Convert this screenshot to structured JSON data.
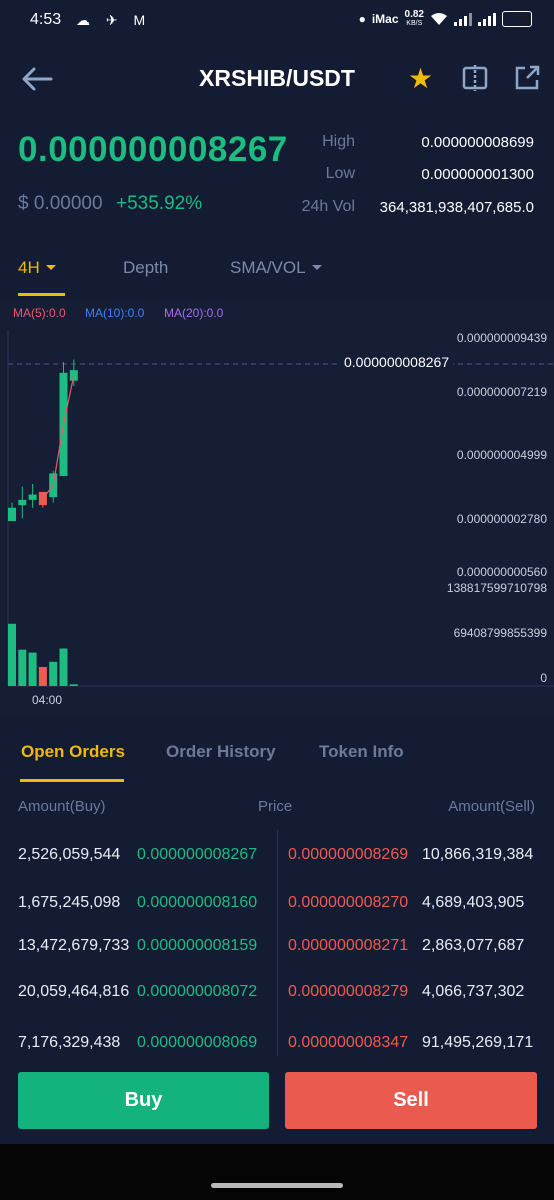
{
  "status": {
    "time": "4:53",
    "left_icons": "☁ ✈ M",
    "imac": "iMac",
    "speed": "0.82",
    "speed_unit": "KB/S",
    "battery": "59"
  },
  "header": {
    "title": "XRSHIB/USDT",
    "back_icon": "arrow-left-icon",
    "favorite_icon": "star-icon",
    "compare_icon": "split-view-icon",
    "share_icon": "share-icon"
  },
  "ticker": {
    "last_price": "0.000000008267",
    "usd_price": "$ 0.00000",
    "change_pct": "+535.92%",
    "high_label": "High",
    "high_value": "0.000000008699",
    "low_label": "Low",
    "low_value": "0.000000001300",
    "vol_label": "24h Vol",
    "vol_value": "364,381,938,407,685.0"
  },
  "chart_tabs": {
    "interval": "4H",
    "depth": "Depth",
    "indicators": "SMA/VOL"
  },
  "indicators": {
    "ma5": "MA(5):0.0",
    "ma10": "MA(10):0.0",
    "ma20": "MA(20):0.0"
  },
  "chart_axis": {
    "p1": "0.000000009439",
    "p2": "0.000000007219",
    "p3": "0.000000004999",
    "p4": "0.000000002780",
    "p5": "0.000000000560",
    "v1": "138817599710798",
    "v2": "69408799855399",
    "v3": "0",
    "current": "0.000000008267",
    "time": "04:00"
  },
  "chart_data": {
    "type": "candlestick",
    "price_range": [
      5.6e-10,
      9.439e-09
    ],
    "volume_range": [
      0,
      138817599710798
    ],
    "candles": [
      {
        "open": 2.6e-09,
        "close": 3.1e-09,
        "high": 3.3e-09,
        "low": 2.6e-09,
        "vol": 108000000000000,
        "dir": "up"
      },
      {
        "open": 3.2e-09,
        "close": 3.4e-09,
        "high": 3.9e-09,
        "low": 2.7e-09,
        "vol": 63000000000000,
        "dir": "up"
      },
      {
        "open": 3.4e-09,
        "close": 3.6e-09,
        "high": 4e-09,
        "low": 3.1e-09,
        "vol": 58000000000000,
        "dir": "up"
      },
      {
        "open": 3.7e-09,
        "close": 3.2e-09,
        "high": 3.7e-09,
        "low": 3.1e-09,
        "vol": 33000000000000,
        "dir": "down"
      },
      {
        "open": 3.5e-09,
        "close": 4.4e-09,
        "high": 4.5e-09,
        "low": 3.3e-09,
        "vol": 42000000000000,
        "dir": "up"
      },
      {
        "open": 4.3e-09,
        "close": 8.2e-09,
        "high": 8.6e-09,
        "low": 4.3e-09,
        "vol": 65000000000000,
        "dir": "up"
      },
      {
        "open": 7.9e-09,
        "close": 8.3e-09,
        "high": 8.7e-09,
        "low": 7.7e-09,
        "vol": 3000000000000,
        "dir": "up"
      }
    ]
  },
  "order_tabs": {
    "open_orders": "Open Orders",
    "order_history": "Order History",
    "token_info": "Token Info"
  },
  "orderbook": {
    "col_buy": "Amount(Buy)",
    "col_price": "Price",
    "col_sell": "Amount(Sell)",
    "rows": [
      {
        "amt_buy": "2,526,059,544",
        "px_buy": "0.000000008267",
        "px_sell": "0.000000008269",
        "amt_sell": "10,866,319,384"
      },
      {
        "amt_buy": "1,675,245,098",
        "px_buy": "0.000000008160",
        "px_sell": "0.000000008270",
        "amt_sell": "4,689,403,905"
      },
      {
        "amt_buy": "13,472,679,733",
        "px_buy": "0.000000008159",
        "px_sell": "0.000000008271",
        "amt_sell": "2,863,077,687"
      },
      {
        "amt_buy": "20,059,464,816",
        "px_buy": "0.000000008072",
        "px_sell": "0.000000008279",
        "amt_sell": "4,066,737,302"
      },
      {
        "amt_buy": "7,176,329,438",
        "px_buy": "0.000000008069",
        "px_sell": "0.000000008347",
        "amt_sell": "91,495,269,171"
      }
    ]
  },
  "actions": {
    "buy": "Buy",
    "sell": "Sell"
  },
  "colors": {
    "up": "#1dbc80",
    "down": "#f05a4f",
    "accent": "#f0b90b",
    "ma5": "#e85a6a",
    "ma10": "#3b82f6",
    "ma20": "#a66cf0"
  }
}
